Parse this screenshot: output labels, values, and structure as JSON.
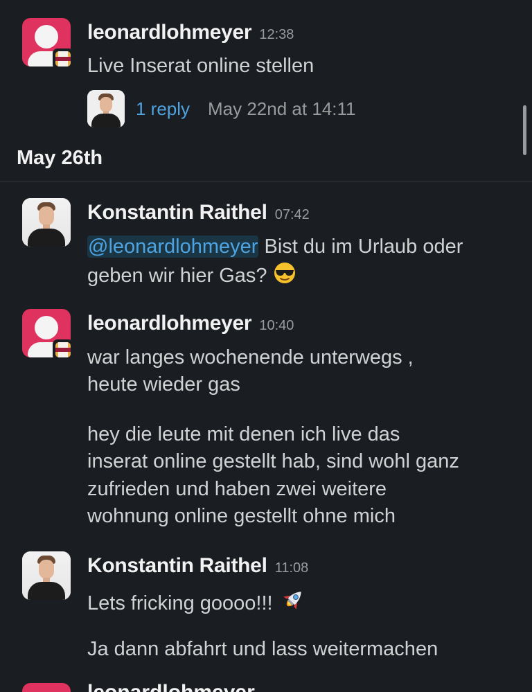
{
  "messages": [
    {
      "author": "leonardlohmeyer",
      "time": "12:38",
      "lines": [
        "Live Inserat online stellen"
      ],
      "thread": {
        "reply_label": "1 reply",
        "last_reply": "May 22nd at 14:11"
      }
    },
    {
      "author": "Konstantin Raithel",
      "time": "07:42",
      "mention": "@leonardlohmeyer",
      "line1_rest": " Bist du im Urlaub oder",
      "line2": "geben wir hier Gas?",
      "emoji": "sunglasses-emoji"
    },
    {
      "author": "leonardlohmeyer",
      "time": "10:40",
      "lines": [
        "war langes wochenende unterwegs ,",
        "heute wieder gas",
        "hey die leute mit denen ich live das",
        "inserat online gestellt hab, sind wohl ganz",
        "zufrieden und haben zwei weitere",
        "wohnung online gestellt ohne mich"
      ]
    },
    {
      "author": "Konstantin Raithel",
      "time": "11:08",
      "lines": [
        "Lets fricking goooo!!!",
        "Ja dann abfahrt und lass weitermachen"
      ],
      "emoji": "rocket-emoji"
    }
  ],
  "date_divider": "May 26th",
  "partial_next_author": "leonardlohmeyer",
  "colors": {
    "background": "#1a1d21",
    "text": "#d1d2d3",
    "link": "#4fa3e0",
    "muted": "#9a9b9d",
    "avatar_leo": "#e0325f"
  }
}
